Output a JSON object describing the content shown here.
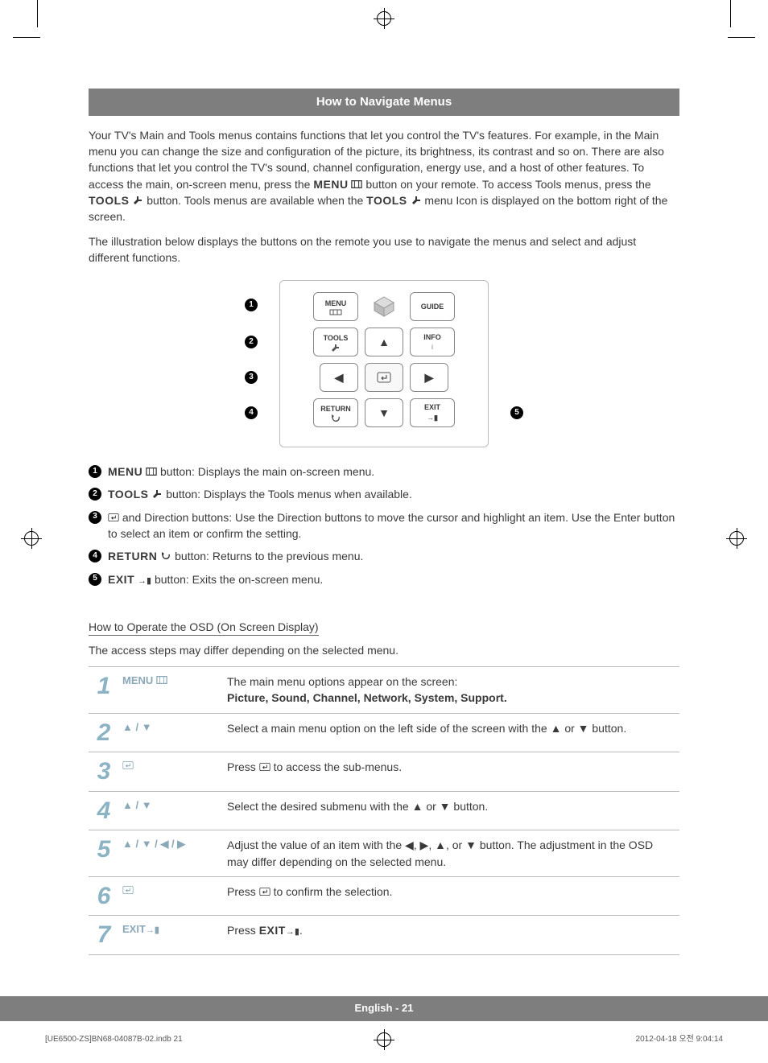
{
  "header_title": "How to Navigate Menus",
  "intro_p1_a": "Your TV's Main and Tools menus contains functions that let you control the TV's features. For example, in the Main menu you can change the size and configuration of the picture, its brightness, its contrast and so on. There are also functions that let you control the TV's sound, channel configuration, energy use, and a host of other features. To access the main, on-screen menu, press the ",
  "intro_menu_btn": "MENU",
  "intro_p1_b": " button on your remote. To access Tools menus, press the ",
  "intro_tools_btn": "TOOLS",
  "intro_p1_c": " button. Tools menus are available when the ",
  "intro_p1_d": " menu Icon is displayed on the bottom right of the screen.",
  "intro_p2": "The illustration below displays the buttons on the remote you use to navigate the menus and select and adjust different functions.",
  "remote": {
    "menu": "MENU",
    "guide": "GUIDE",
    "tools": "TOOLS",
    "info": "INFO",
    "info_sub": "i",
    "return": "RETURN",
    "exit": "EXIT"
  },
  "legend": {
    "l1_label": "MENU",
    "l1_text": " button: Displays the main on-screen menu.",
    "l2_label": "TOOLS",
    "l2_text": " button: Displays the Tools menus when available.",
    "l3_text": " and Direction buttons: Use the Direction buttons to move the cursor and highlight an item. Use the Enter button to select an item or confirm the setting.",
    "l4_label": "RETURN",
    "l4_text": " button: Returns to the previous menu.",
    "l5_label": "EXIT",
    "l5_text": " button: Exits the on-screen menu."
  },
  "osd_heading": "How to Operate the OSD (On Screen Display)",
  "osd_intro": "The access steps may differ depending on the selected menu.",
  "steps": {
    "s1_key": "MENU",
    "s1_desc_a": "The main menu options appear on the screen:",
    "s1_desc_b": "Picture, Sound, Channel, Network, System, Support.",
    "s2_key": "▲ / ▼",
    "s2_desc": "Select a main menu option on the left side of the screen with the ▲ or ▼ button.",
    "s3_desc": "Press E to access the sub-menus.",
    "s4_key": "▲ / ▼",
    "s4_desc": "Select the desired submenu with the ▲ or ▼ button.",
    "s5_key": "▲ / ▼ / ◀ / ▶",
    "s5_desc": "Adjust the value of an item with the ◀, ▶, ▲, or ▼ button. The adjustment in the OSD may differ depending on the selected menu.",
    "s6_desc": "Press E to confirm the selection.",
    "s7_key": "EXIT",
    "s7_desc_a": "Press ",
    "s7_desc_b": "EXIT",
    "s7_desc_c": "."
  },
  "footer_lang": "English - 21",
  "print_footer_left": "[UE6500-ZS]BN68-04087B-02.indb   21",
  "print_footer_right": "2012-04-18   오전 9:04:14"
}
